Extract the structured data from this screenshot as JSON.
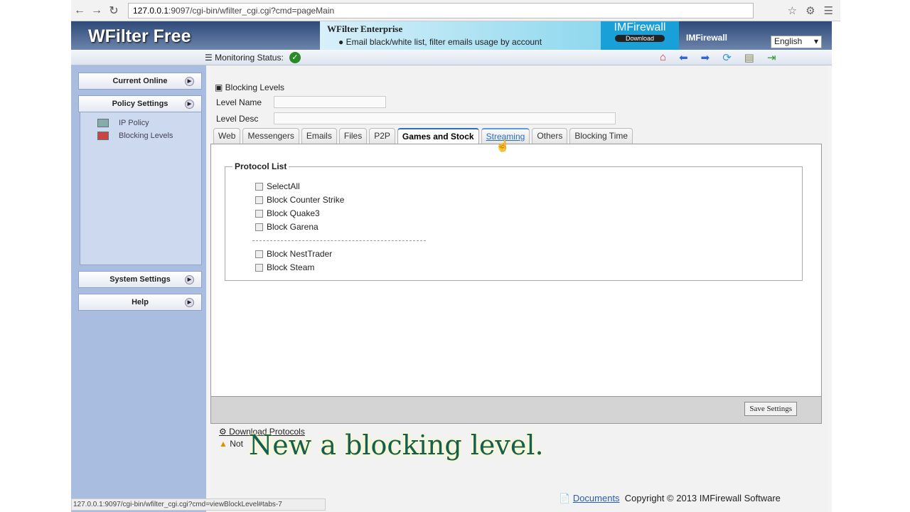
{
  "browser": {
    "url_host": "127.0.0.1",
    "url_rest": ":9097/cgi-bin/wfilter_cgi.cgi?cmd=pageMain",
    "status_url": "127.0.0.1:9097/cgi-bin/wfilter_cgi.cgi?cmd=viewBlockLevel#tabs-7"
  },
  "header": {
    "logo": "WFilter Free",
    "ad_title": "WFilter Enterprise",
    "ad_desc": "Email black/white list, filter emails usage by account",
    "imf": "IMFirewall",
    "imf_download": "Download",
    "imf_label": "IMFirewall",
    "language": "English"
  },
  "statusbar": {
    "label": "Monitoring Status:"
  },
  "sidebar": {
    "current_online": "Current Online",
    "policy_settings": "Policy Settings",
    "items": [
      {
        "label": "IP Policy"
      },
      {
        "label": "Blocking Levels"
      }
    ],
    "system_settings": "System Settings",
    "help": "Help"
  },
  "main": {
    "title": "Blocking Levels",
    "level_name": "Level Name",
    "level_desc": "Level Desc",
    "tabs": [
      {
        "label": "Web"
      },
      {
        "label": "Messengers"
      },
      {
        "label": "Emails"
      },
      {
        "label": "Files"
      },
      {
        "label": "P2P"
      },
      {
        "label": "Games and Stock"
      },
      {
        "label": "Streaming"
      },
      {
        "label": "Others"
      },
      {
        "label": "Blocking Time"
      }
    ],
    "protocol_list": "Protocol List",
    "checks": [
      {
        "label": "SelectAll"
      },
      {
        "label": "Block Counter Strike"
      },
      {
        "label": "Block Quake3"
      },
      {
        "label": "Block Garena"
      },
      {
        "label": "Block NestTrader"
      },
      {
        "label": "Block Steam"
      }
    ],
    "save": "Save Settings",
    "download": "Download Protocols",
    "note": "Not"
  },
  "caption": "New a blocking level.",
  "footer": {
    "documents": "Documents",
    "copyright": "Copyright © 2013   IMFirewall Software"
  }
}
